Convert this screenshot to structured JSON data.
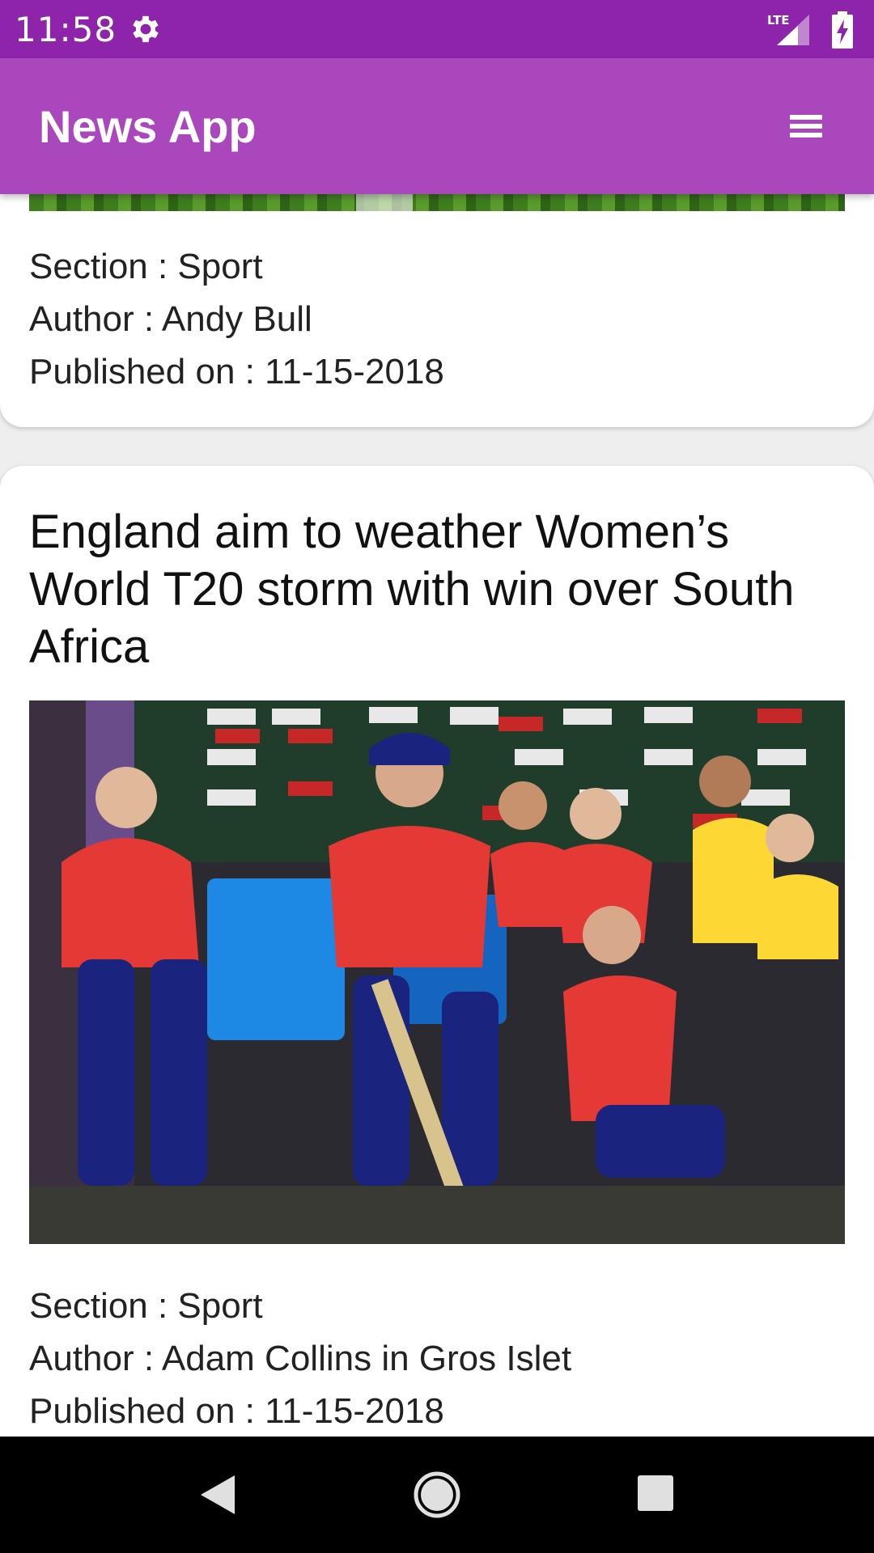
{
  "status_bar": {
    "time": "11:58",
    "network": "LTE",
    "icons": [
      "gear-icon",
      "lte-signal-icon",
      "battery-charging-icon"
    ]
  },
  "app_bar": {
    "title": "News App",
    "menu_icon": "menu-icon"
  },
  "articles": [
    {
      "section": "Section : Sport",
      "author": "Author : Andy Bull",
      "published": "Published on : 11-15-2018"
    },
    {
      "title": "England aim to weather Women’s World T20 storm with win over South Africa",
      "image": "photo of England women's cricket team seated in dugout",
      "section": "Section : Sport",
      "author": "Author : Adam Collins in Gros Islet",
      "published": "Published on : 11-15-2018"
    }
  ],
  "nav_bar": {
    "icons": [
      "back-icon",
      "home-icon",
      "recents-icon"
    ]
  },
  "colors": {
    "status_bar": "#8e24aa",
    "app_bar": "#ab47bc",
    "card": "#ffffff",
    "background": "#eeeeee"
  }
}
